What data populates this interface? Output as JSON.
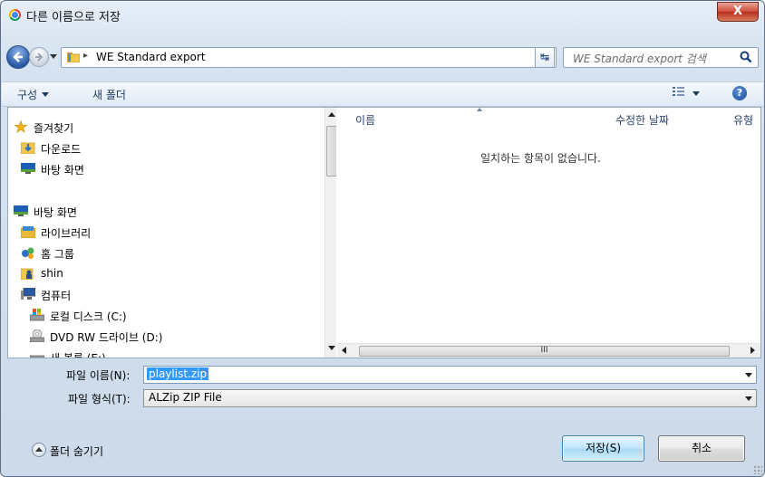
{
  "window": {
    "title": "다른 이름으로 저장",
    "close_glyph": "X"
  },
  "nav": {
    "path_separator": "▸",
    "path": "WE Standard export",
    "search_placeholder": "WE Standard export 검색"
  },
  "toolbar": {
    "organize": "구성",
    "new_folder": "새 폴더",
    "help": "?"
  },
  "sidebar": {
    "items": [
      {
        "label": "즐겨찾기",
        "icon": "star-icon"
      },
      {
        "label": "다운로드",
        "icon": "downloads-folder-icon"
      },
      {
        "label": "바탕 화면",
        "icon": "desktop-icon"
      },
      {
        "label": "바탕 화면",
        "icon": "desktop-icon"
      },
      {
        "label": "라이브러리",
        "icon": "library-icon"
      },
      {
        "label": "홈 그룹",
        "icon": "homegroup-icon"
      },
      {
        "label": "shin",
        "icon": "user-folder-icon"
      },
      {
        "label": "컴퓨터",
        "icon": "computer-icon"
      },
      {
        "label": "로컬 디스크 (C:)",
        "icon": "local-disk-icon"
      },
      {
        "label": "DVD RW 드라이브 (D:)",
        "icon": "dvd-drive-icon"
      },
      {
        "label": "새 볼륨 (E:)",
        "icon": "drive-icon"
      }
    ]
  },
  "filelist": {
    "columns": [
      "이름",
      "수정한 날짜",
      "유형"
    ],
    "empty_message": "일치하는 항목이 없습니다.",
    "hscroll_grip": "III"
  },
  "form": {
    "filename_label": "파일 이름(N):",
    "filename_value": "playlist.zip",
    "filetype_label": "파일 형식(T):",
    "filetype_value": "ALZip ZIP File"
  },
  "footer": {
    "hide_folders": "폴더 숨기기",
    "save": "저장(S)",
    "cancel": "취소"
  }
}
